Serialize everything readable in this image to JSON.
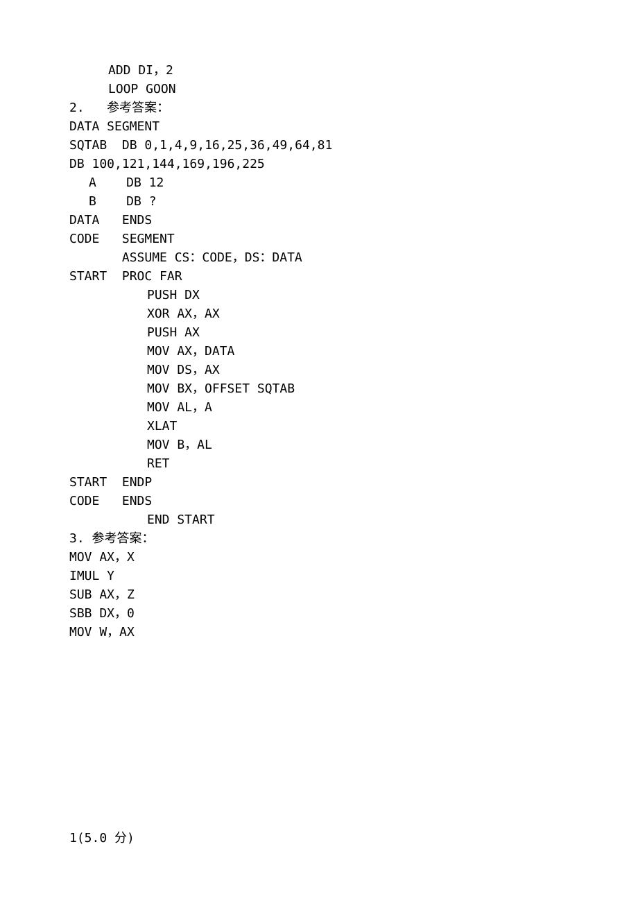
{
  "lines": [
    {
      "text": "ADD DI，2",
      "cls": "indent1"
    },
    {
      "text": "LOOP GOON",
      "cls": "indent1"
    },
    {
      "text": "2.   参考答案：",
      "cls": ""
    },
    {
      "text": "DATA SEGMENT",
      "cls": ""
    },
    {
      "text": "SQTAB  DB 0,1,4,9,16,25,36,49,64,81",
      "cls": ""
    },
    {
      "text": "DB 100,121,144,169,196,225",
      "cls": ""
    },
    {
      "text": "A    DB 12",
      "cls": "indent2"
    },
    {
      "text": "B    DB ?",
      "cls": "indent2"
    },
    {
      "text": "DATA   ENDS",
      "cls": ""
    },
    {
      "text": "CODE   SEGMENT",
      "cls": ""
    },
    {
      "text": "       ASSUME CS：CODE，DS：DATA",
      "cls": ""
    },
    {
      "text": "START  PROC FAR",
      "cls": ""
    },
    {
      "text": "PUSH DX",
      "cls": "indent3"
    },
    {
      "text": "XOR AX，AX",
      "cls": "indent3"
    },
    {
      "text": "PUSH AX",
      "cls": "indent3"
    },
    {
      "text": "MOV AX，DATA",
      "cls": "indent3"
    },
    {
      "text": "MOV DS，AX",
      "cls": "indent3"
    },
    {
      "text": "MOV BX，OFFSET SQTAB",
      "cls": "indent3"
    },
    {
      "text": "MOV AL，A",
      "cls": "indent3"
    },
    {
      "text": "XLAT",
      "cls": "indent3"
    },
    {
      "text": "MOV B，AL",
      "cls": "indent3"
    },
    {
      "text": "RET",
      "cls": "indent3"
    },
    {
      "text": "START  ENDP",
      "cls": ""
    },
    {
      "text": "CODE   ENDS",
      "cls": ""
    },
    {
      "text": "END START",
      "cls": "indent3"
    },
    {
      "text": "3. 参考答案：",
      "cls": ""
    },
    {
      "text": "MOV AX，X",
      "cls": ""
    },
    {
      "text": "IMUL Y",
      "cls": ""
    },
    {
      "text": "SUB AX，Z",
      "cls": ""
    },
    {
      "text": "SBB DX，0",
      "cls": ""
    },
    {
      "text": "MOV W，AX",
      "cls": ""
    }
  ],
  "footer": "1(5.0 分)"
}
